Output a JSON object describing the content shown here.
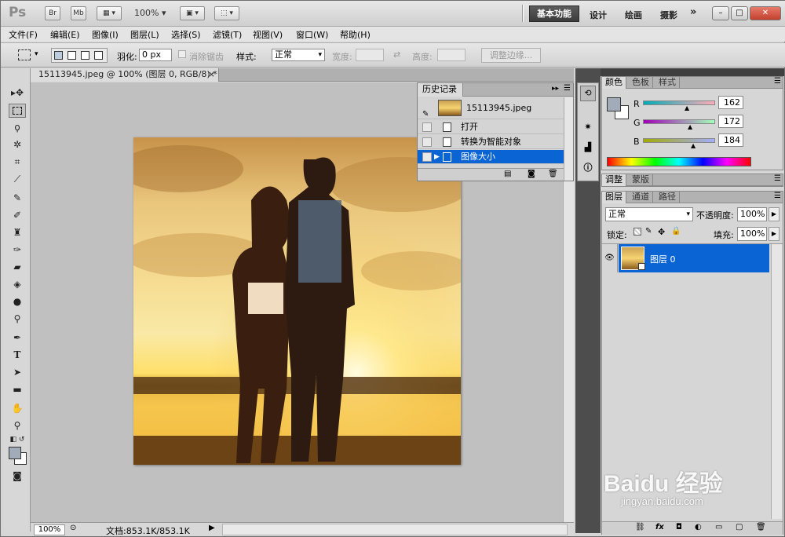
{
  "app": {
    "logo": "Ps",
    "bridge_btn": "Br",
    "minibridge_btn": "Mb",
    "zoom": "100%",
    "workspaces": [
      "基本功能",
      "设计",
      "绘画",
      "摄影",
      "»"
    ],
    "window_controls": [
      "–",
      "□",
      "✕"
    ]
  },
  "menu": [
    "文件(F)",
    "编辑(E)",
    "图像(I)",
    "图层(L)",
    "选择(S)",
    "滤镜(T)",
    "视图(V)",
    "窗口(W)",
    "帮助(H)"
  ],
  "options": {
    "feather_label": "羽化:",
    "feather_value": "0 px",
    "antialias_label": "消除锯齿",
    "style_label": "样式:",
    "style_value": "正常",
    "width_label": "宽度:",
    "height_label": "高度:",
    "refine_edge": "调整边缘..."
  },
  "document": {
    "tab_title": "15113945.jpeg @ 100% (图层 0, RGB/8) *",
    "close": "×",
    "status_zoom": "100%",
    "status_info": "文档:853.1K/853.1K"
  },
  "history": {
    "tab": "历史记录",
    "snapshot": "15113945.jpeg",
    "steps": [
      "打开",
      "转换为智能对象",
      "图像大小"
    ],
    "selected_step": "图像大小"
  },
  "color": {
    "tabs": [
      "颜色",
      "色板",
      "样式"
    ],
    "r_label": "R",
    "g_label": "G",
    "b_label": "B",
    "r": "162",
    "g": "172",
    "b": "184",
    "fg_color": "#a2acb8"
  },
  "adjust": {
    "tabs": [
      "调整",
      "蒙版"
    ]
  },
  "layers": {
    "tabs": [
      "图层",
      "通道",
      "路径"
    ],
    "blend_mode": "正常",
    "opacity_label": "不透明度:",
    "opacity": "100%",
    "lock_label": "锁定:",
    "fill_label": "填充:",
    "fill": "100%",
    "layer_name": "图层 0",
    "footer_icons": [
      "link-icon",
      "fx-icon",
      "mask-icon",
      "adjustment-icon",
      "group-icon",
      "new-layer-icon",
      "trash-icon"
    ],
    "fx_label": "fx"
  },
  "watermark": {
    "text": "Baidu 经验",
    "url": "jingyan.baidu.com"
  },
  "colors": {
    "selection_blue": "#0a64d4",
    "active_workspace": "#4a4a4a"
  }
}
